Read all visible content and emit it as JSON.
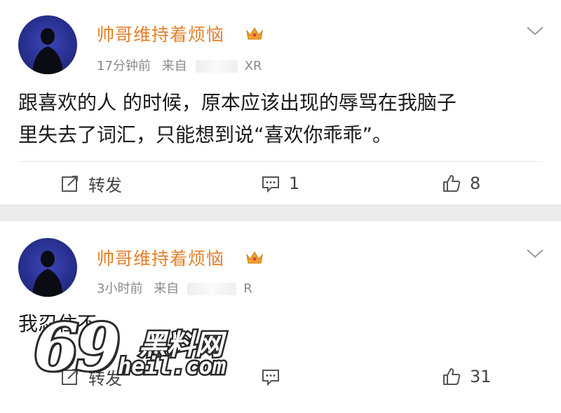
{
  "posts": [
    {
      "username": "帅哥维持着烦恼",
      "time": "17分钟前",
      "source_prefix": "来自",
      "source_suffix": "XR",
      "content_line1": "跟喜欢的人 的时候，原本应该出现的辱骂在我脑子",
      "content_line2": "里失去了词汇，只能想到说“喜欢你乖乖”。",
      "repost_label": "转发",
      "comment_count": "1",
      "like_count": "8"
    },
    {
      "username": "帅哥维持着烦恼",
      "time": "3小时前",
      "source_prefix": "来自",
      "source_suffix": "R",
      "content_line1": "我忍住不",
      "repost_label": "转发",
      "comment_count": "",
      "like_count": "31"
    }
  ],
  "watermark": {
    "number": "69",
    "brand": "黑料网",
    "url": "heil.com"
  },
  "colors": {
    "username": "#e0832a",
    "background": "#ebebeb",
    "card": "#ffffff",
    "meta_text": "#8a8a8a"
  },
  "icons": [
    "avatar-silhouette",
    "crown-icon",
    "chevron-down-icon",
    "repost-icon",
    "comment-icon",
    "like-icon"
  ]
}
